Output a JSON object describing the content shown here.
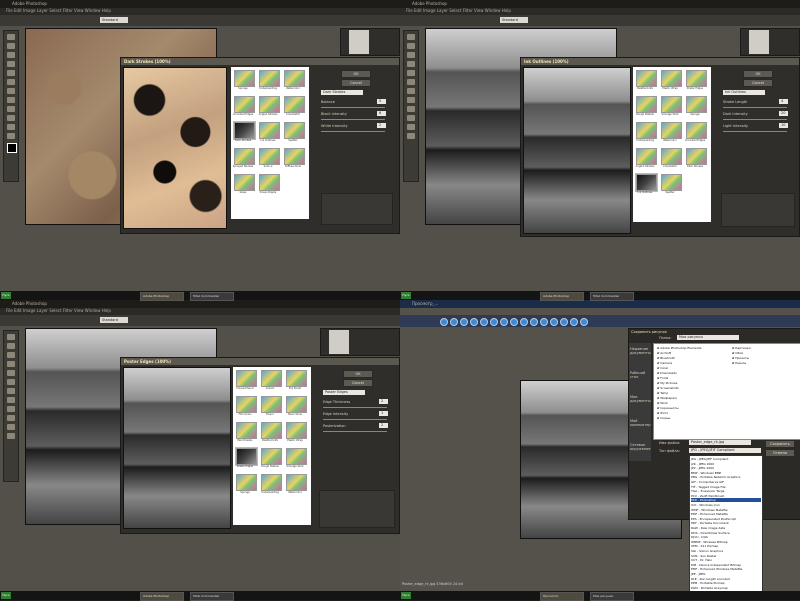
{
  "app": {
    "title": "Adobe Photoshop",
    "menu": "File Edit Image Layer Select Filter View Window Help",
    "zoom_mode": "Standard"
  },
  "quadrants": {
    "q1": {
      "dialog_title": "Dark Strokes (100%)",
      "filter_name": "Dark Strokes",
      "params": [
        {
          "label": "Balance",
          "value": "5"
        },
        {
          "label": "Black Intensity",
          "value": "6"
        },
        {
          "label": "White Intensity",
          "value": "2"
        }
      ],
      "buttons": {
        "ok": "OK",
        "cancel": "Cancel"
      },
      "thumbs": [
        "Sponge",
        "Underpainting",
        "Watercolor",
        "Accented Edges",
        "Angled Strokes",
        "Crosshatch",
        "Dark Strokes",
        "Ink Outlines",
        "Spatter",
        "Sprayed Strokes",
        "Sumi-e",
        "Diffuse Glow",
        "Glass",
        "Ocean Ripple"
      ]
    },
    "q2": {
      "dialog_title": "Ink Outlines (100%)",
      "filter_name": "Ink Outlines",
      "params": [
        {
          "label": "Stroke Length",
          "value": "4"
        },
        {
          "label": "Dark Intensity",
          "value": "20"
        },
        {
          "label": "Light Intensity",
          "value": "10"
        }
      ],
      "buttons": {
        "ok": "OK",
        "cancel": "Cancel"
      },
      "thumbs": [
        "Palette Knife",
        "Plastic Wrap",
        "Poster Edges",
        "Rough Pastels",
        "Smudge Stick",
        "Sponge",
        "Underpainting",
        "Watercolor",
        "Accented Edges",
        "Angled Strokes",
        "Crosshatch",
        "Dark Strokes",
        "Ink Outlines",
        "Spatter"
      ]
    },
    "q3": {
      "dialog_title": "Poster Edges (100%)",
      "filter_name": "Poster Edges",
      "params": [
        {
          "label": "Edge Thickness",
          "value": "2"
        },
        {
          "label": "Edge Intensity",
          "value": "1"
        },
        {
          "label": "Posterization",
          "value": "2"
        }
      ],
      "buttons": {
        "ok": "OK",
        "cancel": "Cancel"
      },
      "thumbs": [
        "Colored Pencil",
        "Cutout",
        "Dry Brush",
        "Film Grain",
        "Fresco",
        "Neon Glow",
        "Paint Daubs",
        "Palette Knife",
        "Plastic Wrap",
        "Poster Edges",
        "Rough Pastels",
        "Smudge Stick",
        "Sponge",
        "Underpainting",
        "Watercolor"
      ]
    },
    "q4": {
      "window_title": "Просмотр_...",
      "save_title": "Сохранить рисунок",
      "places": [
        "Недавние документы",
        "Рабочий стол",
        "Мои документы",
        "Мой компьютер",
        "Сетевое окружение"
      ],
      "folder_label": "Папка:",
      "folder_value": "Мои рисунки",
      "files": [
        "Adobe Photoshop Elements",
        "ArcSoft",
        "Bluetooth",
        "Camera",
        "Corel",
        "Downloads",
        "Fonts",
        "My Pictures",
        "Screenshots",
        "Temp",
        "Wallpapers",
        "Work",
        "Скриншоты",
        "Фото",
        "Сканы"
      ],
      "files_right": [
        "Картинки",
        "Обои",
        "Проекты",
        "Разное"
      ],
      "name_label": "Имя файла:",
      "name_value": "Poster_edge_rk.jpg",
      "type_label": "Тип файла:",
      "type_value": "JPG - JPEG/JFIF Compliant",
      "save_btn": "Сохранить",
      "cancel_btn": "Отмена",
      "formats": [
        "JPG - JPEG/JFIF Compliant",
        "J2K - JPEG 2000",
        "JP2 - JPEG 2000",
        "BMP - Windows BMP",
        "PNG - Portable Network Graphics",
        "GIF - CompuServe GIF",
        "TIF - Tagged Image File",
        "TGA - Truevision Targa",
        "PCX - Zsoft Paintbrush",
        "PSD - Photoshop",
        "ICO - Windows Icon",
        "WMF - Windows Metafile",
        "EMF - Enhanced Metafile",
        "EPS - Encapsulated PostScript",
        "PDF - Portable Document",
        "RAW - Raw image data",
        "DDS - DirectDraw Surface",
        "DJVU - DjVu",
        "WBMP - Wireless Bitmap",
        "XPM - X11 Pixmap",
        "SGI - Silicon Graphics",
        "SUN - Sun Raster",
        "CUT - Dr. Halo",
        "DIB - Device Independent Bitmap",
        "EMF - Enhanced Windows Metafile",
        "JPE - JPEG",
        "RLE - Run length encoded",
        "PPM - Portable Pixmap",
        "PGM - Portable Greymap",
        "PBM - Portable Bitmap",
        "TIFF - Tagged Image File",
        "XBM - X11 Bitmap"
      ],
      "status": "Poster_edge_rk.jpg  536x600  24 bit"
    }
  },
  "taskbar": {
    "start": "Пуск",
    "items": [
      "Adobe Photoshop",
      "Total Commander",
      "Просмотр",
      "Мои рисунки"
    ]
  },
  "colors": {
    "bg": "#53504a",
    "dialog": "#302e2a",
    "accent": "#e6b65a",
    "taskbar": "#141414"
  }
}
